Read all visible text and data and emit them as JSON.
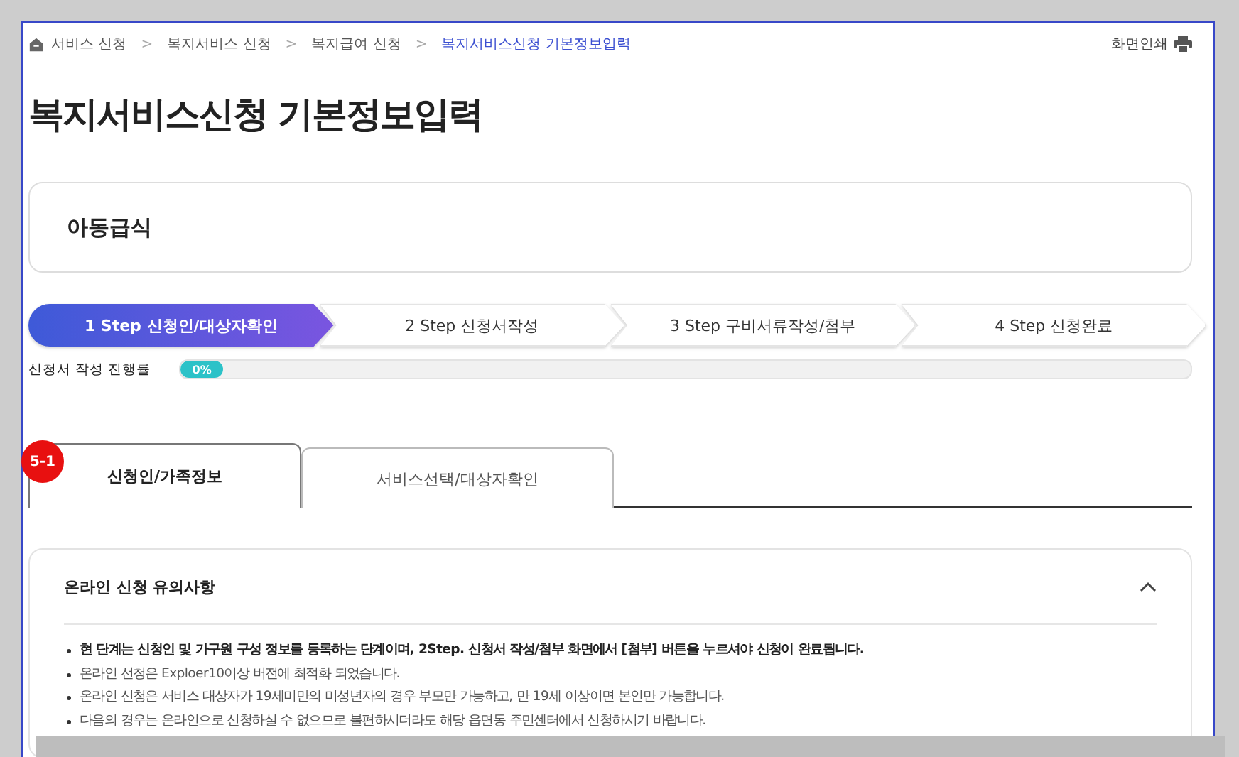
{
  "breadcrumb": {
    "items": [
      {
        "label": "서비스 신청",
        "current": false
      },
      {
        "label": "복지서비스 신청",
        "current": false
      },
      {
        "label": "복지급여 신청",
        "current": false
      },
      {
        "label": "복지서비스신청 기본정보입력",
        "current": true
      }
    ],
    "separator": ">"
  },
  "print_button": "화면인쇄",
  "page_title": "복지서비스신청 기본정보입력",
  "service_name": "아동급식",
  "steps": [
    {
      "label": "1 Step 신청인/대상자확인",
      "selected": true
    },
    {
      "label": "2 Step 신청서작성",
      "selected": false
    },
    {
      "label": "3 Step 구비서류작성/첨부",
      "selected": false
    },
    {
      "label": "4 Step 신청완료",
      "selected": false
    }
  ],
  "progress": {
    "label": "신청서 작성 진행률",
    "level": 0,
    "reading": "0%"
  },
  "annotation_badge": "5-1",
  "tabs": [
    {
      "label": "신청인/가족정보",
      "selected": true
    },
    {
      "label": "서비스선택/대상자확인",
      "selected": false
    }
  ],
  "notice": {
    "title": "온라인 신청 유의사항",
    "expanded": true,
    "items": [
      {
        "text": "현 단계는 신청인 및 가구원 구성 정보를 등록하는 단계이며, 2Step. 신청서 작성/첨부 화면에서 [첨부] 버튼을 누르셔야 신청이 완료됩니다.",
        "bold": true
      },
      {
        "text": "온라인 선청은 Exploer10이상 버전에 최적화 되었습니다.",
        "bold": false
      },
      {
        "text": "온라인 신청은 서비스 대상자가 19세미만의 미성년자의 경우 부모만 가능하고, 만 19세 이상이면 본인만 가능합니다.",
        "bold": false
      },
      {
        "text": "다음의 경우는 온라인으로 신청하실 수 없으므로 불편하시더라도 해당 읍면동 주민센터에서 신청하시기 바랍니다.",
        "bold": false
      }
    ]
  }
}
